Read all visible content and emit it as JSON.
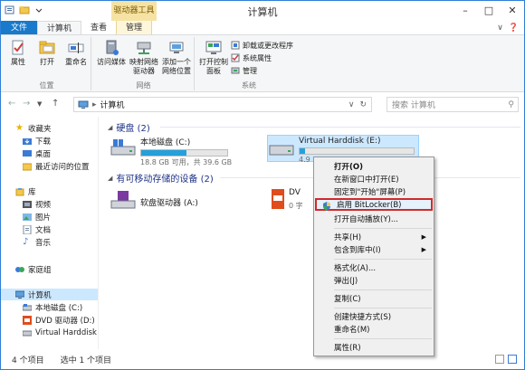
{
  "window": {
    "title": "计算机"
  },
  "ribbon": {
    "tabs": {
      "file": "文件",
      "computer": "计算机",
      "view": "查看",
      "context_header": "驱动器工具",
      "manage": "管理"
    },
    "groups": {
      "location": {
        "label": "位置",
        "buttons": [
          "属性",
          "打开",
          "重命名"
        ]
      },
      "network": {
        "label": "网络",
        "buttons": [
          "访问媒体",
          "映射网络驱动器",
          "添加一个网络位置"
        ]
      },
      "system": {
        "label": "系统",
        "open_cp": "打开控制面板",
        "small": [
          "卸载或更改程序",
          "系统属性",
          "管理"
        ]
      }
    }
  },
  "address": {
    "path": "计算机",
    "search_placeholder": "搜索 计算机"
  },
  "nav": {
    "items": [
      "收藏夹",
      "下载",
      "桌面",
      "最近访问的位置",
      "库",
      "视频",
      "图片",
      "文档",
      "音乐",
      "家庭组",
      "计算机",
      "本地磁盘 (C:)",
      "DVD 驱动器 (D:)",
      "Virtual Harddisk"
    ]
  },
  "content": {
    "hdd_header": "硬盘 (2)",
    "removable_header": "有可移动存储的设备 (2)",
    "drive_c": {
      "name": "本地磁盘 (C:)",
      "usage": "18.8 GB 可用，共 39.6 GB",
      "used_fraction": 0.53
    },
    "drive_e": {
      "name": "Virtual Harddisk (E:)",
      "usage_partial": "4.9",
      "used_fraction": 0.05
    },
    "drive_a": {
      "name": "软盘驱动器 (A:)"
    },
    "drive_dvd": {
      "name_partial": "DV",
      "sub_partial": "0 字"
    }
  },
  "status": {
    "count": "4 个项目",
    "selected": "选中 1 个项目"
  },
  "context_menu": {
    "items": [
      {
        "label": "打开(O)"
      },
      {
        "label": "在新窗口中打开(E)"
      },
      {
        "label": "固定到\"开始\"屏幕(P)"
      },
      {
        "label": "启用 BitLocker(B)"
      },
      {
        "label": "打开自动播放(Y)..."
      },
      {
        "label": "共享(H)"
      },
      {
        "label": "包含到库中(I)"
      },
      {
        "label": "格式化(A)..."
      },
      {
        "label": "弹出(J)"
      },
      {
        "label": "复制(C)"
      },
      {
        "label": "创建快捷方式(S)"
      },
      {
        "label": "重命名(M)"
      },
      {
        "label": "属性(R)"
      }
    ]
  },
  "colors": {
    "accent": "#1979ca",
    "highlight_border": "#d12a2a",
    "selection": "#cce8ff",
    "bar_fill": "#26a0da"
  }
}
